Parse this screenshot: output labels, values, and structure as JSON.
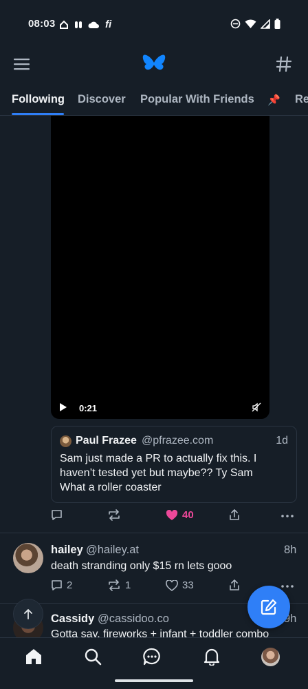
{
  "status_bar": {
    "time": "08:03",
    "left_icons": [
      "home-outline-icon",
      "slack-icon",
      "cloud-icon"
    ],
    "carrier_text": "fi",
    "right_icons": [
      "do-not-disturb-icon",
      "wifi-icon",
      "signal-icon",
      "battery-icon"
    ]
  },
  "header": {
    "menu_icon": "hamburger-menu-icon",
    "logo": "bluesky-butterfly-logo",
    "feeds_icon": "hashtag-icon",
    "brand_color": "#1185fe"
  },
  "tabs": {
    "items": [
      "Following",
      "Discover",
      "Popular With Friends",
      "📌",
      "Re"
    ],
    "active": "Following",
    "accent": "#2f7ff7"
  },
  "video": {
    "duration": "0:21",
    "play_icon": "play-icon",
    "mute_icon": "muted-speaker-icon"
  },
  "quote": {
    "name": "Paul Frazee",
    "handle": "@pfrazee.com",
    "time": "1d",
    "text_line1": "Sam just made a PR to actually fix this. I",
    "text_line2": "haven’t tested yet but maybe?? Ty Sam",
    "text_line3": "What a roller coaster"
  },
  "post1_actions": {
    "replies": "",
    "reposts": "",
    "likes": "40",
    "liked": true,
    "like_color": "#ec4899"
  },
  "post2": {
    "name": "hailey",
    "handle": "@hailey.at",
    "time": "8h",
    "text": "death stranding only $15 rn lets gooo",
    "replies": "2",
    "reposts": "1",
    "likes": "33"
  },
  "post3": {
    "name": "Cassidy",
    "handle": "@cassidoo.co",
    "time": "9h",
    "text": "Gotta say, fireworks + infant + toddler combo"
  },
  "bottom_nav": {
    "items": [
      "home-icon",
      "search-icon",
      "chat-icon",
      "notifications-bell-icon",
      "profile-avatar"
    ]
  },
  "fab": {
    "icon": "compose-icon",
    "color": "#2f7ff7"
  }
}
